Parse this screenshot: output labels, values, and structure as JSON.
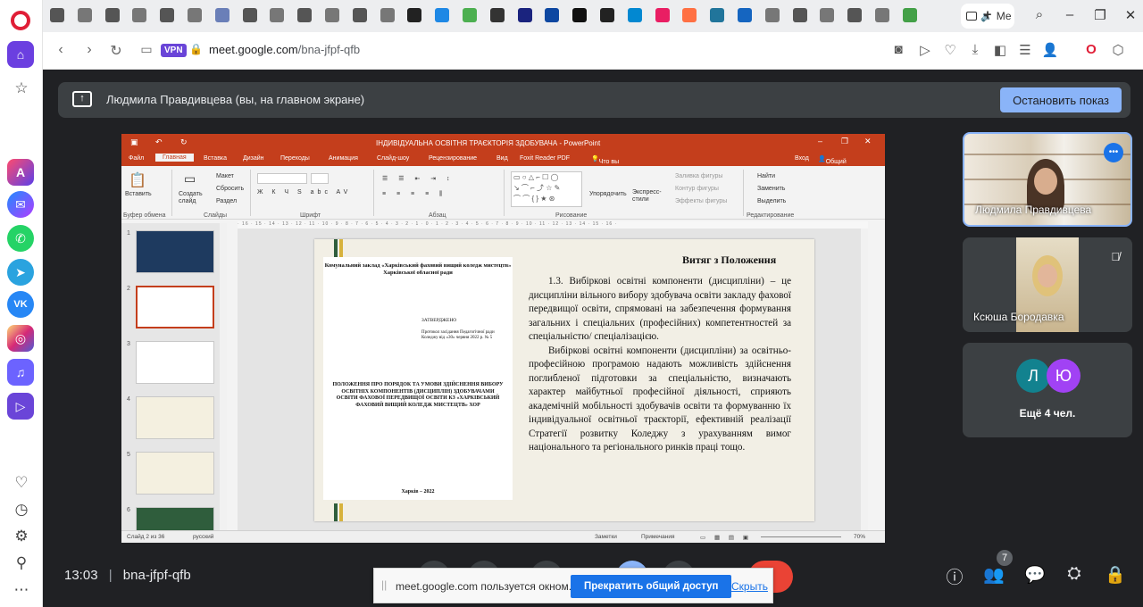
{
  "browser": {
    "active_tab_label": "Ме",
    "url_host": "meet.google.com",
    "url_path": "/bna-jfpf-qfb",
    "vpn_badge": "VPN"
  },
  "meet": {
    "presenter_banner": "Людмила Правдивцева (вы, на главном экране)",
    "stop_presenting": "Остановить показ",
    "time": "13:03",
    "separator": "|",
    "meeting_code": "bna-jfpf-qfb",
    "participants_count": "7",
    "participants": [
      {
        "name": "Людмила Правдивцева"
      },
      {
        "name": "Ксюша Бородавка"
      }
    ],
    "more_people": "Ещё 4 чел.",
    "avatar_letters": [
      "Л",
      "Ю"
    ]
  },
  "share_notice": {
    "text": "meet.google.com пользуется окном.",
    "stop_button": "Прекратить общий доступ",
    "hide_link": "Скрыть"
  },
  "ppt": {
    "window_title": "ІНДИВІДУАЛЬНА ОСВІТНЯ ТРАЄКТОРІЯ ЗДОБУВАЧА - PowerPoint",
    "menu": [
      "Файл",
      "Главная",
      "Вставка",
      "Дизайн",
      "Переходы",
      "Анимация",
      "Слайд-шоу",
      "Рецензирование",
      "Вид",
      "Foxit Reader PDF"
    ],
    "tell_me": "Что вы хотите сделать?",
    "sign_in": "Вход",
    "share": "Общий доступ",
    "groups": [
      "Буфер обмена",
      "Слайды",
      "Шрифт",
      "Абзац",
      "Рисование",
      "Редактирование"
    ],
    "ribbon_labels": {
      "paste": "Вставить",
      "new_slide": "Создать слайд",
      "layout": "Макет",
      "reset": "Сбросить",
      "section": "Раздел",
      "arrange": "Упорядочить",
      "quick_styles": "Экспресс-стили",
      "fill": "Заливка фигуры",
      "outline": "Контур фигуры",
      "effects": "Эффекты фигуры",
      "find": "Найти",
      "replace": "Заменить",
      "select": "Выделить"
    },
    "thumb_numbers": [
      "1",
      "2",
      "3",
      "4",
      "5",
      "6"
    ],
    "status": {
      "slide_of": "Слайд 2 из 36",
      "language": "русский",
      "notes": "Заметки",
      "comments": "Примечания",
      "zoom": "70%"
    },
    "slide": {
      "heading": "Витяг з Положення",
      "doc_org": "Комунальний заклад «Харківський фаховий вищий коледж мистецтв» Харківської обласної ради",
      "doc_approved": "ЗАТВЕРДЖЕНО",
      "doc_protocol": "Протокол засідання Педагогічної ради Коледжу від «30» червня 2022 р. № 5",
      "doc_title": "ПОЛОЖЕННЯ ПРО ПОРЯДОК ТА УМОВИ ЗДІЙСНЕННЯ ВИБОРУ ОСВІТНІХ КОМПОНЕНТІВ (ДИСЦИПЛІН) ЗДОБУВАЧАМИ ОСВІТИ ФАХОВОЇ ПЕРЕДВИЩОЇ ОСВІТИ КЗ «ХАРКІВСЬКИЙ ФАХОВИЙ ВИЩИЙ КОЛЕДЖ МИСТЕЦТВ» ХОР",
      "doc_city": "Харків – 2022",
      "paragraph1": "1.3. Вибіркові освітні компоненти (дисципліни) – це дисципліни вільного вибору здобувача освіти закладу фахової передвищої освіти, спрямовані на забезпечення формування загальних і спеціальних (професійних) компетентностей за спеціальністю/ спеціалізацією.",
      "paragraph2": "Вибіркові освітні компоненти (дисципліни) за освітньо-професійною програмою надають можливість здійснення поглибленої підготовки за спеціальністю, визначають характер майбутньої професійної діяльності, сприяють академічній мобільності здобувачів освіти та формуванню їх індивідуальної освітньої траєкторії, ефективній реалізації Стратегії розвитку Коледжу з урахуванням вимог національного та регіонального ринків праці тощо."
    }
  },
  "colors": {
    "meet_bg": "#202124",
    "ppt_red": "#c43e1c",
    "accent_blue": "#8ab4f8",
    "notif_blue": "#1a73e8",
    "avatar_l": "#12828f",
    "avatar_yu": "#a142f4"
  },
  "icons": {
    "sidebar": [
      "opera-logo",
      "home-icon",
      "star-icon",
      "aria-icon",
      "messenger-icon",
      "whatsapp-icon",
      "telegram-icon",
      "vk-icon",
      "instagram-icon",
      "music-icon",
      "player-icon",
      "heart-icon",
      "history-icon",
      "settings-icon",
      "bulb-icon",
      "more-icon"
    ],
    "bottom": [
      "info-icon",
      "people-icon",
      "chat-icon",
      "activities-icon",
      "host-controls-icon"
    ]
  }
}
